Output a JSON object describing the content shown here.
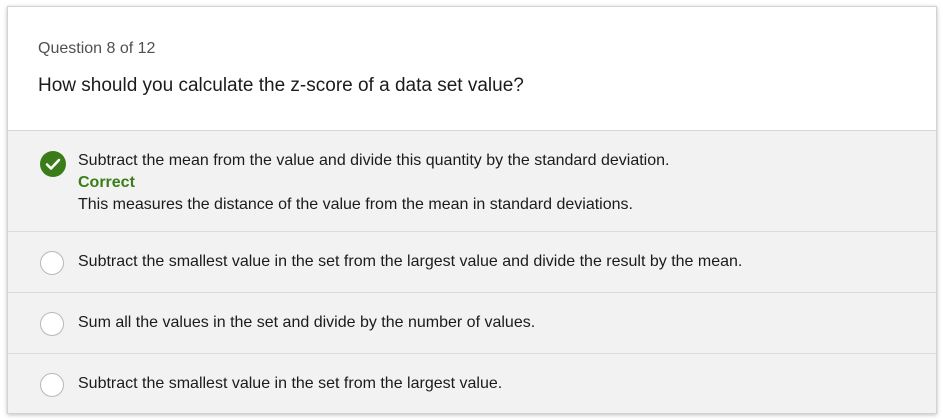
{
  "quiz": {
    "counter": "Question 8 of 12",
    "question": "How should you calculate the z-score of a data set value?",
    "options": [
      {
        "text": "Subtract the mean from the value and divide this quantity by the standard deviation.",
        "selected": true,
        "status": "Correct",
        "explanation": "This measures the distance of the value from the mean in standard deviations."
      },
      {
        "text": "Subtract the smallest value in the set from the largest value and divide the result by the mean.",
        "selected": false
      },
      {
        "text": "Sum all the values in the set and divide by the number of values.",
        "selected": false
      },
      {
        "text": "Subtract the smallest value in the set from the largest value.",
        "selected": false
      }
    ]
  },
  "colors": {
    "correct_green": "#3a7d18",
    "option_background": "#f2f2f2",
    "radio_border": "#b8b8b8"
  },
  "icons": {
    "selected_option": "check-circle-icon",
    "unselected_option": "radio-empty-icon"
  }
}
